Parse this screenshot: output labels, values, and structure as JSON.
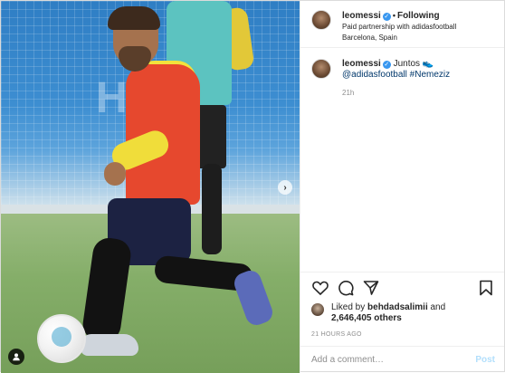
{
  "header": {
    "username": "leomessi",
    "verified_symbol": "✓",
    "separator": "•",
    "follow_status": "Following",
    "subtitle": "Paid partnership with adidasfootball",
    "location": "Barcelona, Spain"
  },
  "media": {
    "fence_text": "H  AR",
    "next_symbol": "›"
  },
  "caption": {
    "username": "leomessi",
    "text": "Juntos",
    "emoji": "👟",
    "mention": "@adidasfootball",
    "hashtag": "#Nemeziz",
    "time_ago": "21h"
  },
  "icons": [
    "heart-icon",
    "comment-icon",
    "share-icon",
    "bookmark-icon",
    "carousel-next-icon",
    "user-tag-icon",
    "verified-icon"
  ],
  "likes": {
    "prefix": "Liked by",
    "user": "behdadsalimii",
    "connector": "and",
    "count_text": "2,646,405 others"
  },
  "post_date": "21 HOURS AGO",
  "add_comment": {
    "placeholder": "Add a comment…",
    "post_label": "Post"
  },
  "colors": {
    "link": "#00376b",
    "verified": "#3897f0",
    "post_button_disabled": "#b2dffc"
  }
}
